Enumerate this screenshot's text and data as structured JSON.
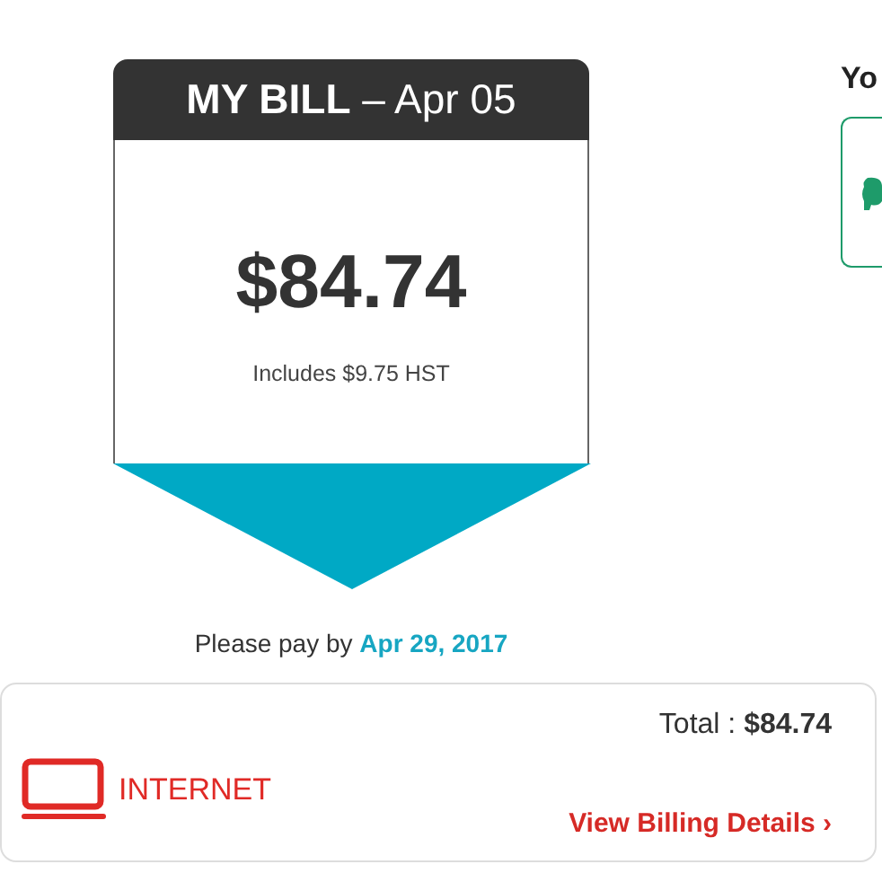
{
  "bill": {
    "title": "**MY BILL** – Apr 05",
    "amount": "$84.74",
    "tax_note": "Includes $9.75 HST",
    "pay_by_label": "Please pay by",
    "pay_by_date": "Apr 29, 2017"
  },
  "side": {
    "heading": "Yo"
  },
  "service": {
    "name": "INTERNET",
    "total": "Total : **$84.74**",
    "link": "View Billing Details",
    "link_icon": "›"
  }
}
